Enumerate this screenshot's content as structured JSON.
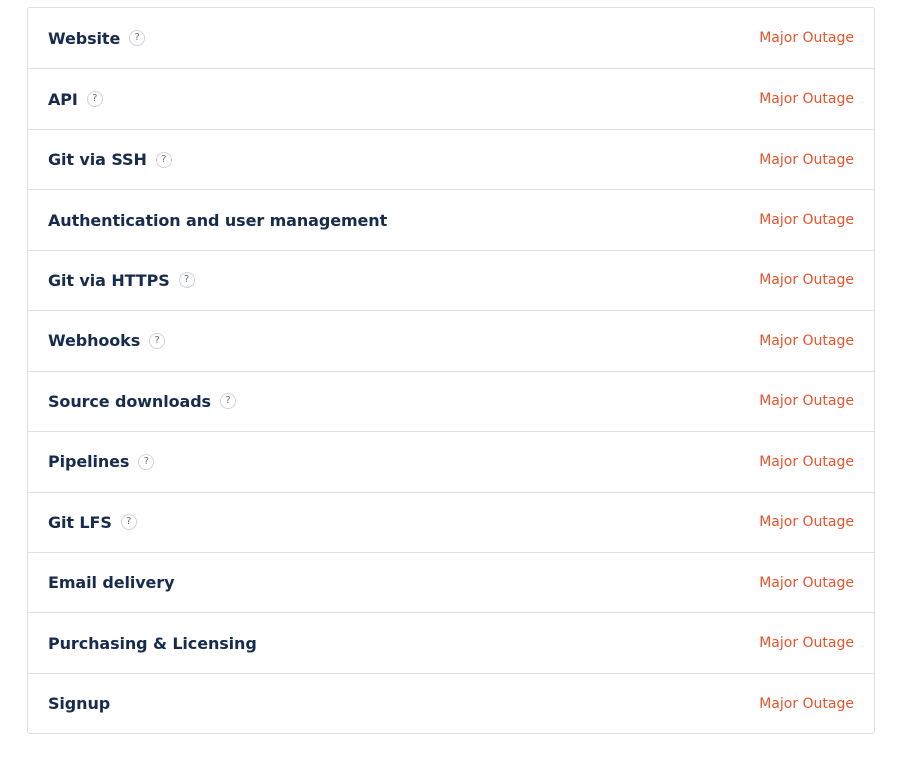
{
  "components": [
    {
      "name": "Website",
      "help": "?",
      "has_help": true,
      "status": "Major Outage"
    },
    {
      "name": "API",
      "help": "?",
      "has_help": true,
      "status": "Major Outage"
    },
    {
      "name": "Git via SSH",
      "help": "?",
      "has_help": true,
      "status": "Major Outage"
    },
    {
      "name": "Authentication and user management",
      "help": "?",
      "has_help": false,
      "status": "Major Outage"
    },
    {
      "name": "Git via HTTPS",
      "help": "?",
      "has_help": true,
      "status": "Major Outage"
    },
    {
      "name": "Webhooks",
      "help": "?",
      "has_help": true,
      "status": "Major Outage"
    },
    {
      "name": "Source downloads",
      "help": "?",
      "has_help": true,
      "status": "Major Outage"
    },
    {
      "name": "Pipelines",
      "help": "?",
      "has_help": true,
      "status": "Major Outage"
    },
    {
      "name": "Git LFS",
      "help": "?",
      "has_help": true,
      "status": "Major Outage"
    },
    {
      "name": "Email delivery",
      "help": "?",
      "has_help": false,
      "status": "Major Outage"
    },
    {
      "name": "Purchasing & Licensing",
      "help": "?",
      "has_help": false,
      "status": "Major Outage"
    },
    {
      "name": "Signup",
      "help": "?",
      "has_help": false,
      "status": "Major Outage"
    }
  ],
  "colors": {
    "major_outage": "#e5542c",
    "component_name": "#172b4d",
    "border": "#e0e0e0"
  },
  "icons": {
    "help": "question-mark-circle-icon"
  }
}
